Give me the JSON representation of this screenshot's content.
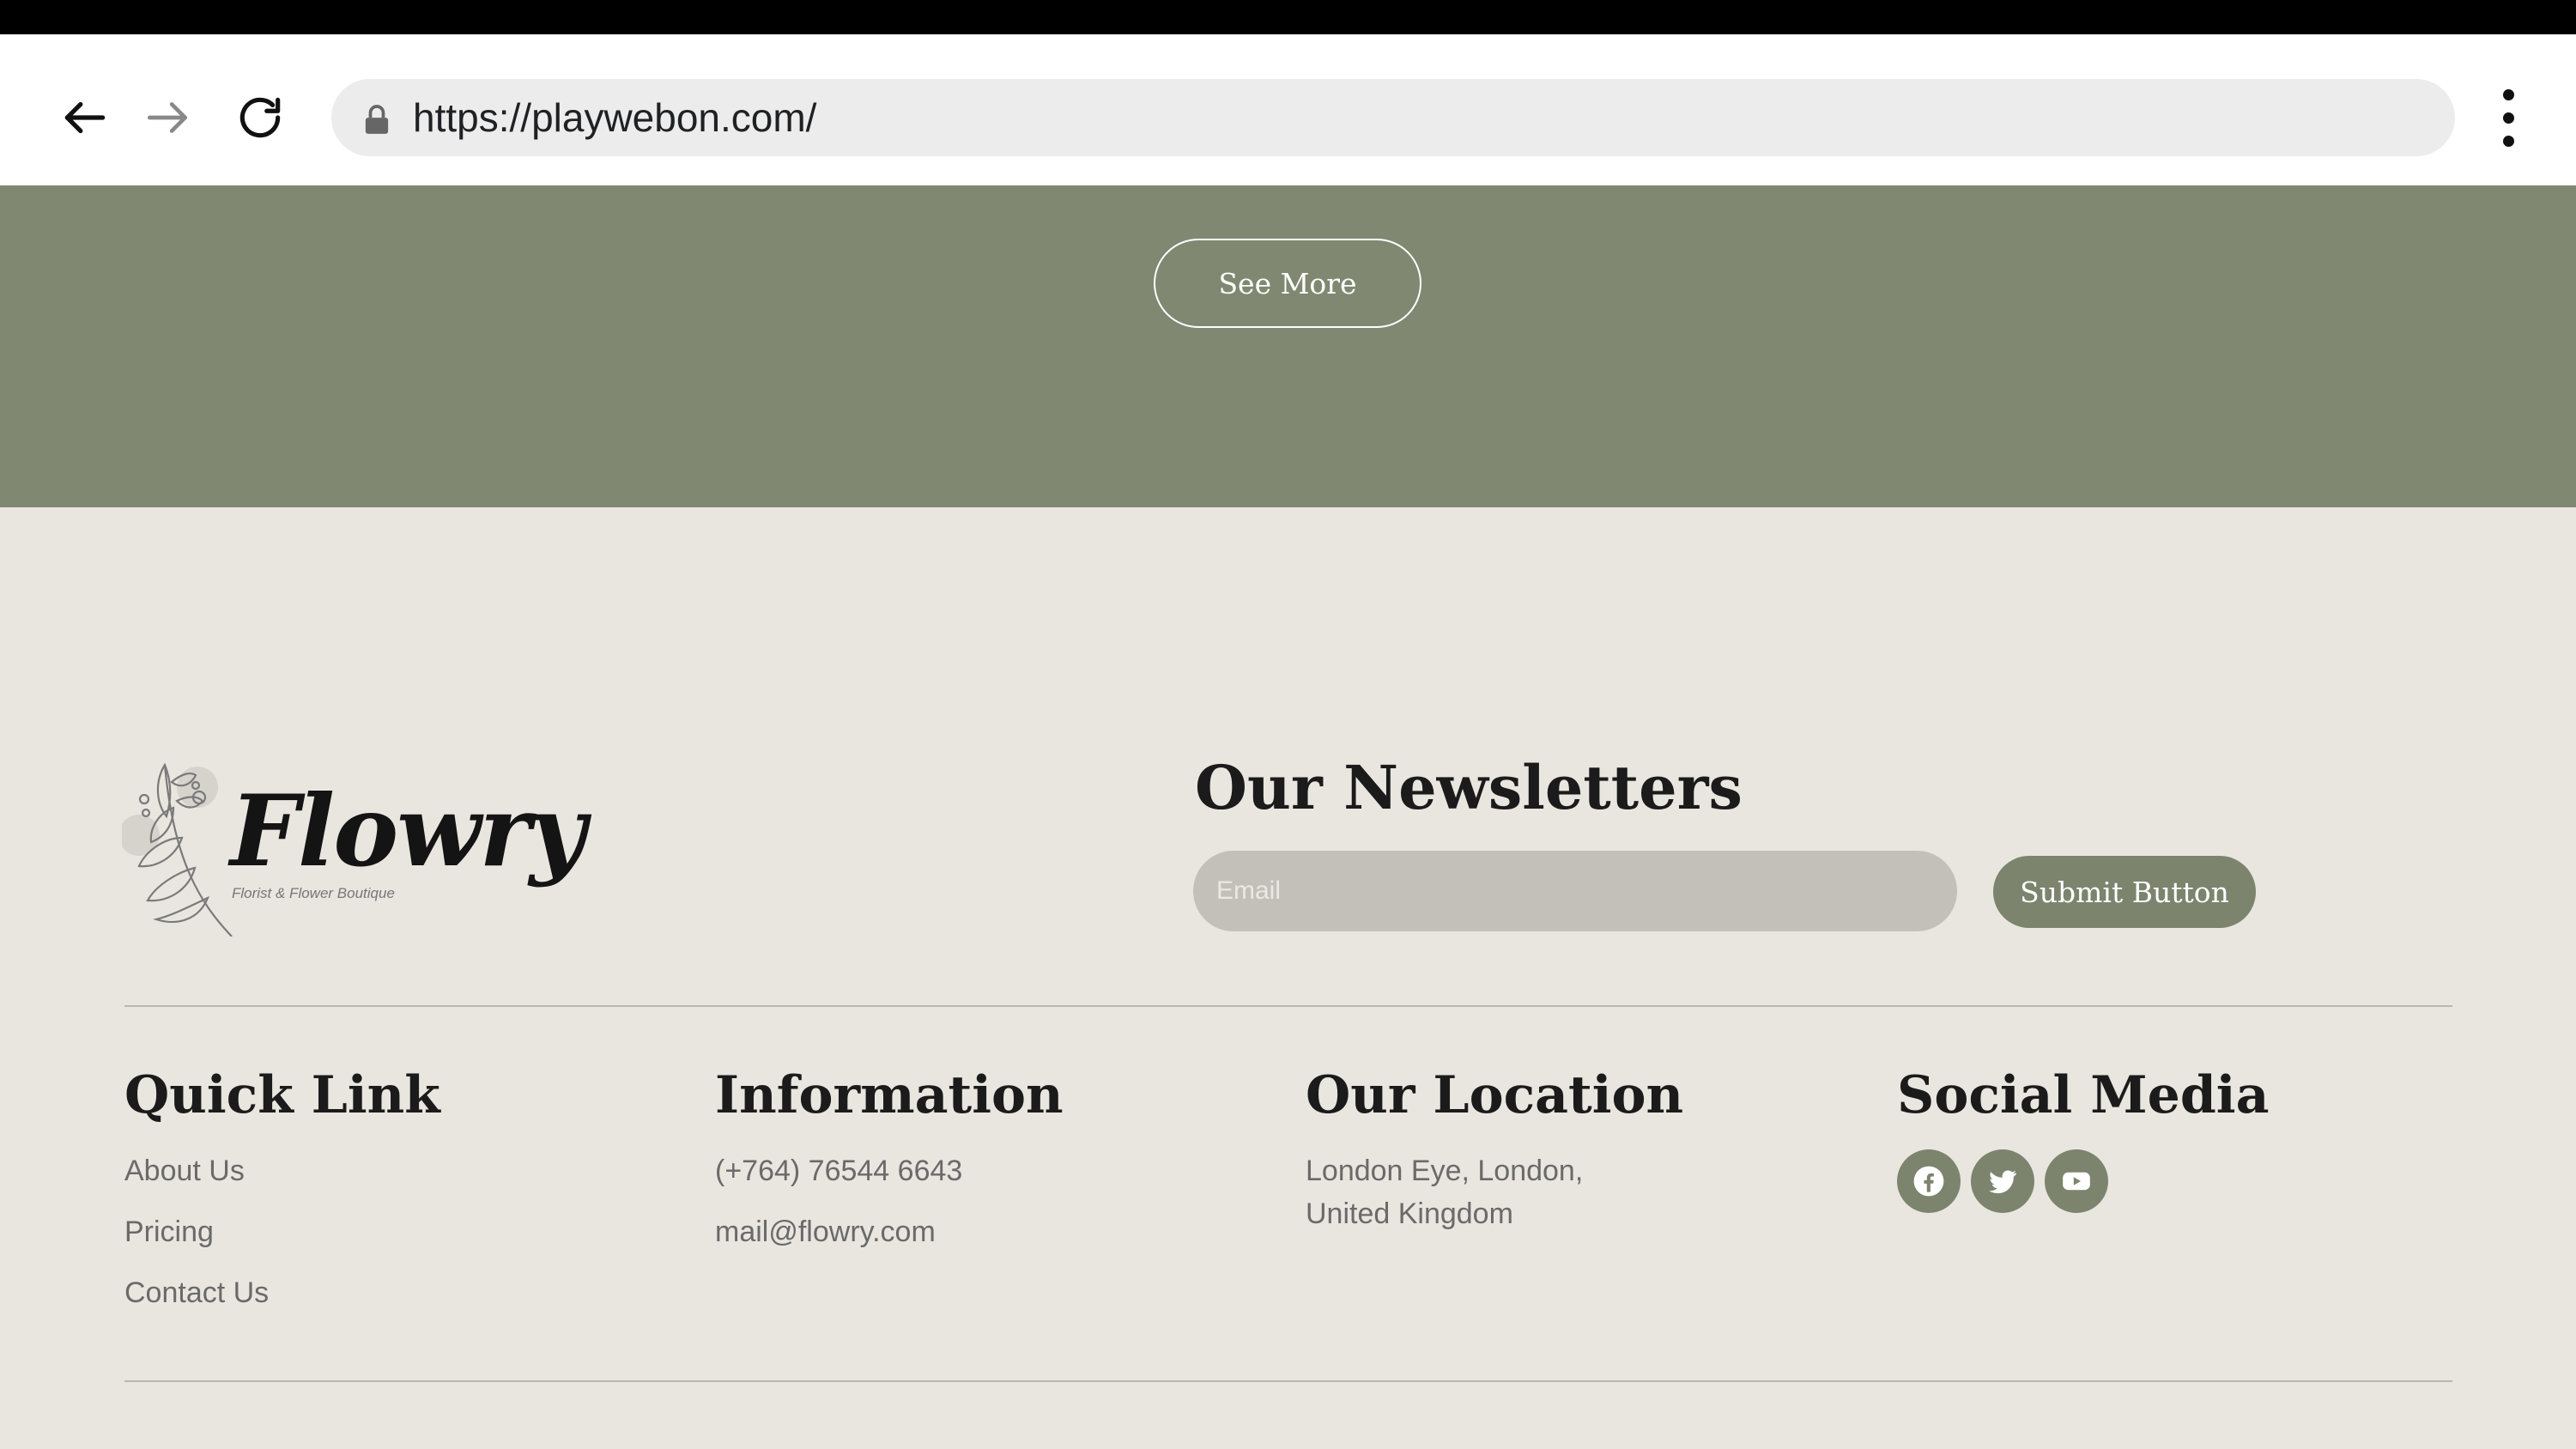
{
  "browser": {
    "url": "https://playwebon.com/"
  },
  "hero": {
    "see_more_label": "See More"
  },
  "brand": {
    "logo_text": "Flowry",
    "tagline": "Florist & Flower Boutique"
  },
  "newsletter": {
    "title": "Our Newsletters",
    "email_placeholder": "Email",
    "submit_label": "Submit Button"
  },
  "footer": {
    "quick_link": {
      "title": "Quick Link",
      "items": [
        "About Us",
        "Pricing",
        "Contact Us"
      ]
    },
    "information": {
      "title": "Information",
      "phone": "(+764) 76544 6643",
      "email": "mail@flowry.com"
    },
    "location": {
      "title": "Our Location",
      "line1": "London Eye, London,",
      "line2": "United Kingdom"
    },
    "social": {
      "title": "Social Media",
      "icons": [
        "facebook-icon",
        "twitter-icon",
        "youtube-icon"
      ]
    }
  },
  "colors": {
    "accent_green": "#808872",
    "button_green": "#7c846e",
    "footer_bg": "#e9e6e0"
  }
}
